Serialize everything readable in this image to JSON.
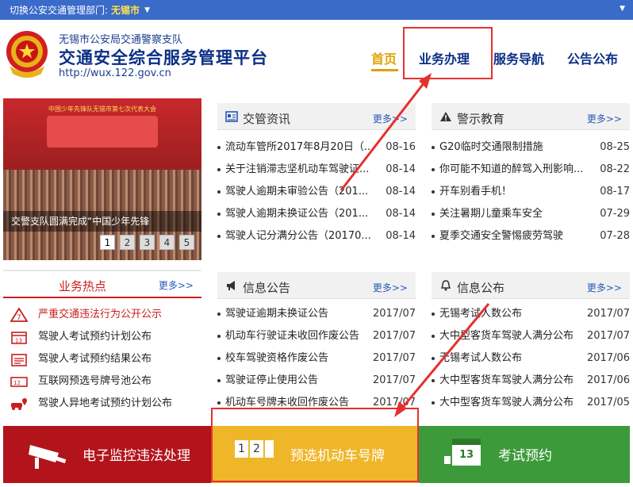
{
  "topbar": {
    "switch_label": "切换公安交通管理部门:",
    "city": "无锡市"
  },
  "header": {
    "subtitle": "无锡市公安局交通警察支队",
    "title": "交通安全综合服务管理平台",
    "url": "http://wux.122.gov.cn"
  },
  "nav": {
    "home": "首页",
    "business": "业务办理",
    "guide": "服务导航",
    "notice": "公告公布"
  },
  "banner": {
    "stage_text": "中国少年先锋队无锡市第七次代表大会",
    "caption": "交警支队圆满完成“中国少年先锋",
    "pages": [
      "1",
      "2",
      "3",
      "4",
      "5"
    ],
    "active_page": "1"
  },
  "news": {
    "title": "交管资讯",
    "more": "更多>>",
    "items": [
      {
        "text": "流动车管所2017年8月20日（...",
        "date": "08-16"
      },
      {
        "text": "关于注销滞志坚机动车驾驶证...",
        "date": "08-14"
      },
      {
        "text": "驾驶人逾期未审验公告（201...",
        "date": "08-14"
      },
      {
        "text": "驾驶人逾期未换证公告（201...",
        "date": "08-14"
      },
      {
        "text": "驾驶人记分满分公告（20170...",
        "date": "08-14"
      }
    ]
  },
  "warning": {
    "title": "警示教育",
    "more": "更多>>",
    "items": [
      {
        "text": "G20临时交通限制措施",
        "date": "08-25"
      },
      {
        "text": "你可能不知道的醉驾入刑影响...",
        "date": "08-22"
      },
      {
        "text": "开车别看手机！",
        "date": "08-17"
      },
      {
        "text": "关注暑期儿童乘车安全",
        "date": "07-29"
      },
      {
        "text": "夏季交通安全警惕疲劳驾驶",
        "date": "07-28"
      }
    ]
  },
  "hot": {
    "title": "业务热点",
    "more": "更多>>",
    "items": [
      {
        "text": "严重交通违法行为公开公示",
        "icon": "warning-triangle-icon"
      },
      {
        "text": "驾驶人考试预约计划公布",
        "icon": "calendar-icon"
      },
      {
        "text": "驾驶人考试预约结果公布",
        "icon": "calendar-list-icon"
      },
      {
        "text": "互联网预选号牌号池公布",
        "icon": "plate-icon"
      },
      {
        "text": "驾驶人异地考试预约计划公布",
        "icon": "car-location-icon"
      }
    ]
  },
  "info_notice": {
    "title": "信息公告",
    "more": "更多>>",
    "items": [
      {
        "text": "驾驶证逾期未换证公告",
        "date": "2017/07"
      },
      {
        "text": "机动车行驶证未收回作废公告",
        "date": "2017/07"
      },
      {
        "text": "校车驾驶资格作废公告",
        "date": "2017/07"
      },
      {
        "text": "驾驶证停止使用公告",
        "date": "2017/07"
      },
      {
        "text": "机动车号牌未收回作废公告",
        "date": "2017/07"
      }
    ]
  },
  "info_publish": {
    "title": "信息公布",
    "more": "更多>>",
    "items": [
      {
        "text": "无锡考试人数公布",
        "date": "2017/07"
      },
      {
        "text": "大中型客货车驾驶人满分公布",
        "date": "2017/07"
      },
      {
        "text": "无锡考试人数公布",
        "date": "2017/06"
      },
      {
        "text": "大中型客货车驾驶人满分公布",
        "date": "2017/06"
      },
      {
        "text": "大中型客货车驾驶人满分公布",
        "date": "2017/05"
      }
    ]
  },
  "bottom": {
    "violation": "电子监控违法处理",
    "plate": "预选机动车号牌",
    "plate_icon_digits": [
      "1",
      "2"
    ],
    "exam": "考试预约",
    "exam_calendar_day": "13"
  },
  "colors": {
    "header_blue": "#3a6bc9",
    "brand_navy": "#0b2f86",
    "highlight": "#e0a100",
    "red": "#b3141b",
    "yellow": "#f0b62a",
    "green": "#3d9a3a",
    "annotation": "#e53030"
  }
}
